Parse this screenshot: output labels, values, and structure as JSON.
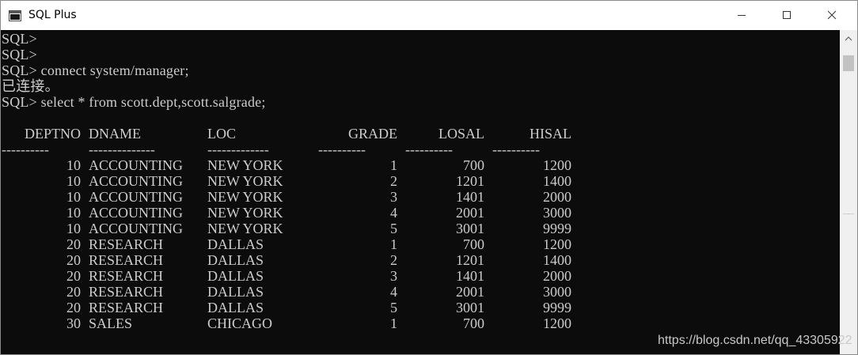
{
  "window": {
    "title": "SQL Plus"
  },
  "console": {
    "lines": [
      "SQL>",
      "SQL>",
      "SQL> connect system/manager;",
      "已连接。",
      "SQL> select * from scott.dept,scott.salgrade;"
    ],
    "headers": [
      "DEPTNO",
      "DNAME",
      "LOC",
      "GRADE",
      "LOSAL",
      "HISAL"
    ],
    "rows": [
      [
        "10",
        "ACCOUNTING",
        "NEW YORK",
        "1",
        "700",
        "1200"
      ],
      [
        "10",
        "ACCOUNTING",
        "NEW YORK",
        "2",
        "1201",
        "1400"
      ],
      [
        "10",
        "ACCOUNTING",
        "NEW YORK",
        "3",
        "1401",
        "2000"
      ],
      [
        "10",
        "ACCOUNTING",
        "NEW YORK",
        "4",
        "2001",
        "3000"
      ],
      [
        "10",
        "ACCOUNTING",
        "NEW YORK",
        "5",
        "3001",
        "9999"
      ],
      [
        "20",
        "RESEARCH",
        "DALLAS",
        "1",
        "700",
        "1200"
      ],
      [
        "20",
        "RESEARCH",
        "DALLAS",
        "2",
        "1201",
        "1400"
      ],
      [
        "20",
        "RESEARCH",
        "DALLAS",
        "3",
        "1401",
        "2000"
      ],
      [
        "20",
        "RESEARCH",
        "DALLAS",
        "4",
        "2001",
        "3000"
      ],
      [
        "20",
        "RESEARCH",
        "DALLAS",
        "5",
        "3001",
        "9999"
      ],
      [
        "30",
        "SALES",
        "CHICAGO",
        "1",
        "700",
        "1200"
      ]
    ]
  },
  "watermark": "https://blog.csdn.net/qq_43305922",
  "colors": {
    "console_background": "#0c0c0c",
    "console_text": "#cccccc",
    "titlebar_background": "#ffffff"
  },
  "icons": {
    "app": "console-app-icon",
    "minimize": "minimize-icon",
    "maximize": "maximize-icon",
    "close": "close-icon",
    "scroll_up": "scroll-up-arrow-icon"
  }
}
